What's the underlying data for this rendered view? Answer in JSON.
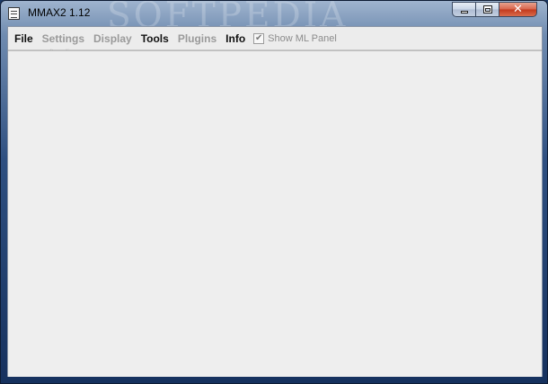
{
  "window": {
    "title": "MMAX2 1.12",
    "watermark": "SOFTPEDIA",
    "watermark_url": "www.softpedia.com"
  },
  "caption_buttons": {
    "minimize": "minimize-icon",
    "maximize": "maximize-icon",
    "close": "✕"
  },
  "menubar": {
    "items": [
      {
        "label": "File",
        "enabled": true
      },
      {
        "label": "Settings",
        "enabled": false
      },
      {
        "label": "Display",
        "enabled": false
      },
      {
        "label": "Tools",
        "enabled": true
      },
      {
        "label": "Plugins",
        "enabled": false
      },
      {
        "label": "Info",
        "enabled": true
      }
    ],
    "show_ml_panel": {
      "label": "Show ML Panel",
      "checked": true,
      "check_glyph": "✔"
    }
  },
  "colors": {
    "client_background": "#eeeeee",
    "disabled_text": "#9a9a9a",
    "title_background": "#2e4f80"
  }
}
